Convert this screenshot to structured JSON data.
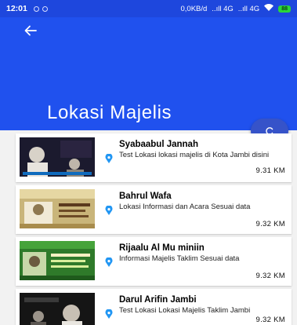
{
  "status_bar": {
    "time": "12:01",
    "network": "0,0KB/d",
    "signal_1": "..ıll 4G",
    "signal_2": "..ıll 4G",
    "battery": "88"
  },
  "header": {
    "back_icon": "arrow-left-icon",
    "title": "Lokasi Majelis"
  },
  "fab": {
    "icon": "refresh-icon"
  },
  "items": [
    {
      "title": "Syabaabul Jannah",
      "description": "Test Lokasi lokasi majelis di Kota Jambi disini",
      "distance": "9.31 KM",
      "thumb_text": "PENGAJIAN BULANAN",
      "thumb_bg": "#1b1a2e"
    },
    {
      "title": "Bahrul Wafa",
      "description": "Lokasi Informasi dan Acara Sesuai data",
      "distance": "9.32 KM",
      "thumb_text": "Majlis Ta'lim",
      "thumb_bg": "#c9b57a"
    },
    {
      "title": "Rijaalu Al Mu miniin",
      "description": "Informasi Majelis Taklim Sesuai data",
      "distance": "9.32 KM",
      "thumb_text": "Ta'lim Pemuda",
      "thumb_bg": "#2f7a2a"
    },
    {
      "title": "Darul Arifin Jambi",
      "description": "Test Lokasi Lokasi Majelis Taklim Jambi",
      "distance": "9.32 KM",
      "thumb_text": "Festival Ta'lim",
      "thumb_bg": "#151515"
    }
  ],
  "colors": {
    "primary": "#2051ee",
    "status_bar": "#1e47dd",
    "fab": "#3653c9",
    "pin": "#2196f3"
  }
}
